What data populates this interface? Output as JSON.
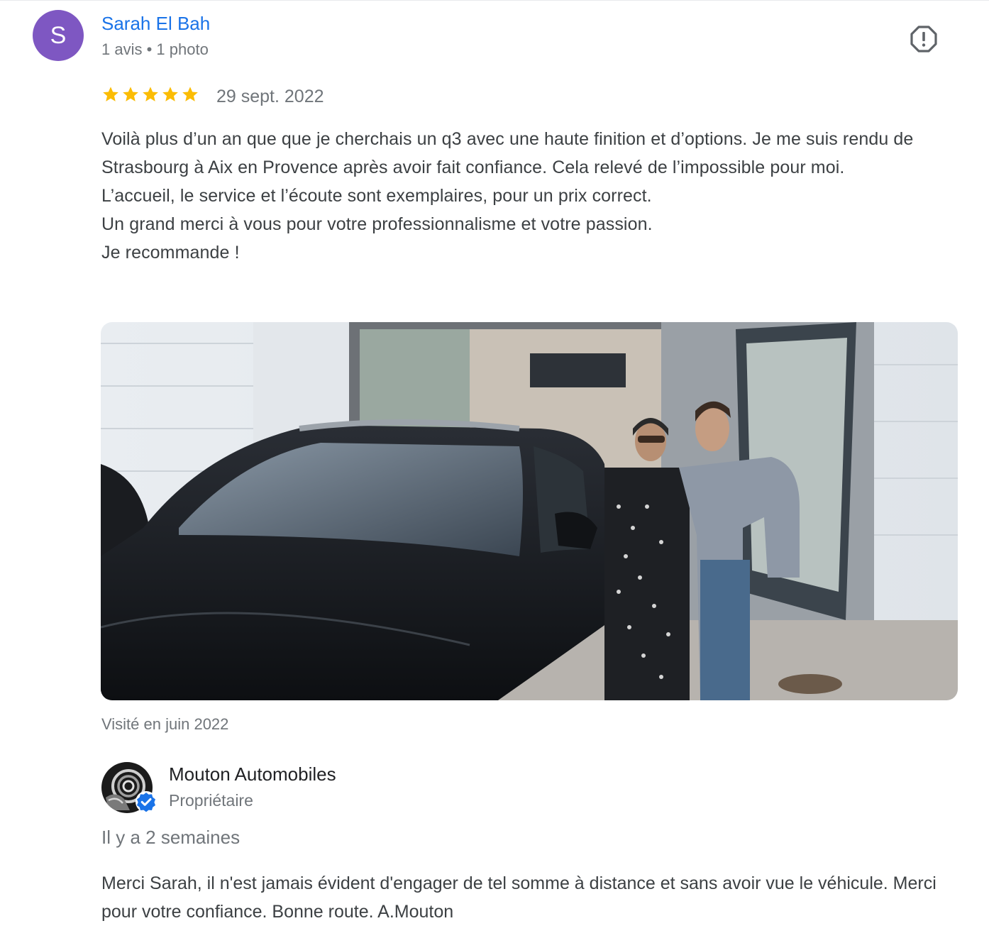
{
  "review": {
    "avatar_letter": "S",
    "avatar_color": "#7e57c2",
    "reviewer_name": "Sarah El Bah",
    "reviewer_meta": "1 avis • 1 photo",
    "rating": 5,
    "max_rating": 5,
    "date": "29 sept. 2022",
    "text": "Voilà plus d’un an que que je cherchais un q3 avec une haute finition et d’options. Je me suis rendu de Strasbourg à Aix en Provence après avoir fait confiance. Cela relevé de l’impossible pour moi.\nL’accueil, le service et l’écoute sont exemplaires, pour un prix correct.\nUn grand merci à vous pour votre professionnalisme et votre passion.\nJe recommande !",
    "visited": "Visité en juin 2022",
    "icons": [
      "report-icon",
      "star-icon"
    ]
  },
  "owner_reply": {
    "name": "Mouton Automobiles",
    "role": "Propriétaire",
    "time": "Il y a 2 semaines",
    "text": "Merci Sarah, il n'est jamais évident d'engager de tel somme à distance et sans avoir vue le véhicule. Merci pour votre confiance. Bonne route. A.Mouton",
    "icons": [
      "ram-logo-icon",
      "verified-badge-icon"
    ]
  },
  "colors": {
    "link": "#1a73e8",
    "star": "#fbbc04",
    "secondary_text": "#70757a",
    "verified": "#1a73e8"
  }
}
